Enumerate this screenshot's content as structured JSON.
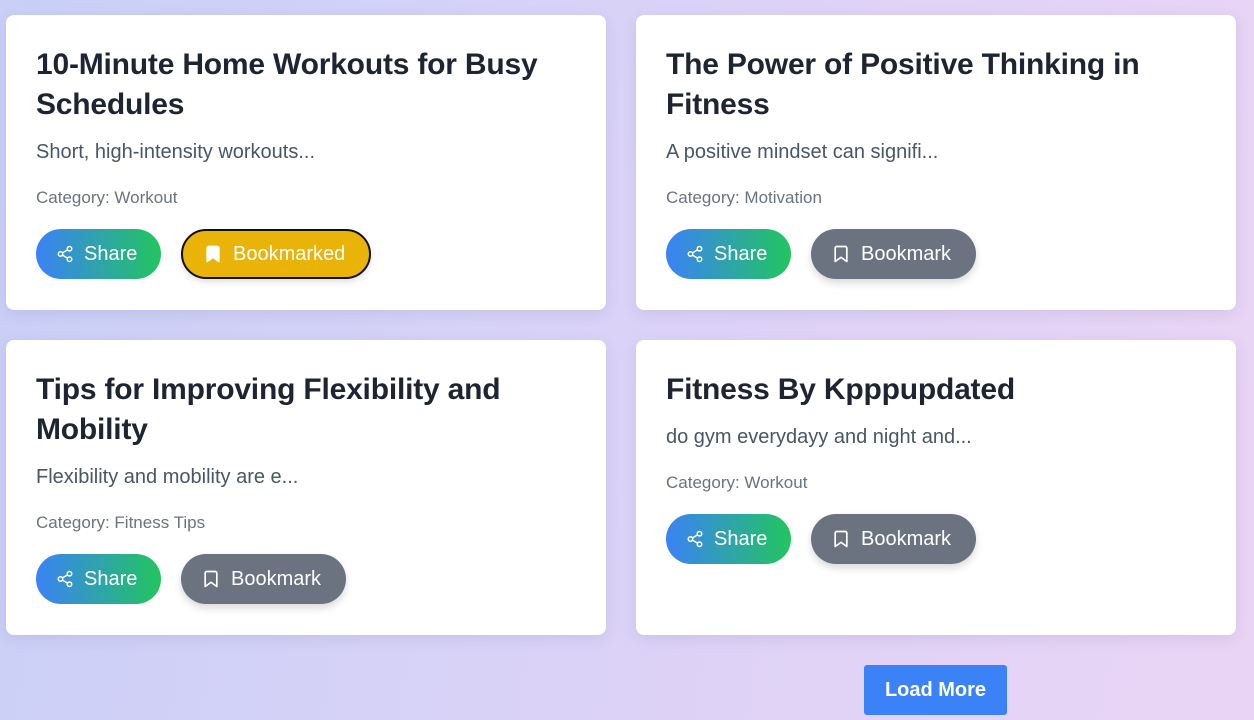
{
  "posts": [
    {
      "title": "10-Minute Home Workouts for Busy Schedules",
      "description": "Short, high-intensity workouts...",
      "category": "Category: Workout",
      "share_label": "Share",
      "bookmark_label": "Bookmarked",
      "bookmarked": true
    },
    {
      "title": "The Power of Positive Thinking in Fitness",
      "description": "A positive mindset can signifi...",
      "category": "Category: Motivation",
      "share_label": "Share",
      "bookmark_label": "Bookmark",
      "bookmarked": false
    },
    {
      "title": "Tips for Improving Flexibility and Mobility",
      "description": "Flexibility and mobility are e...",
      "category": "Category: Fitness Tips",
      "share_label": "Share",
      "bookmark_label": "Bookmark",
      "bookmarked": false
    },
    {
      "title": "Fitness By Kpppupdated",
      "description": "do gym everydayy and night and...",
      "category": "Category: Workout",
      "share_label": "Share",
      "bookmark_label": "Bookmark",
      "bookmarked": false
    }
  ],
  "load_more_label": "Load More",
  "colors": {
    "share_gradient_start": "#3b82f6",
    "share_gradient_end": "#22c55e",
    "bookmark_inactive": "#6b7280",
    "bookmark_active": "#eab308",
    "load_more": "#3b82f6"
  },
  "icons": {
    "share": "share-icon",
    "bookmark": "bookmark-icon"
  }
}
